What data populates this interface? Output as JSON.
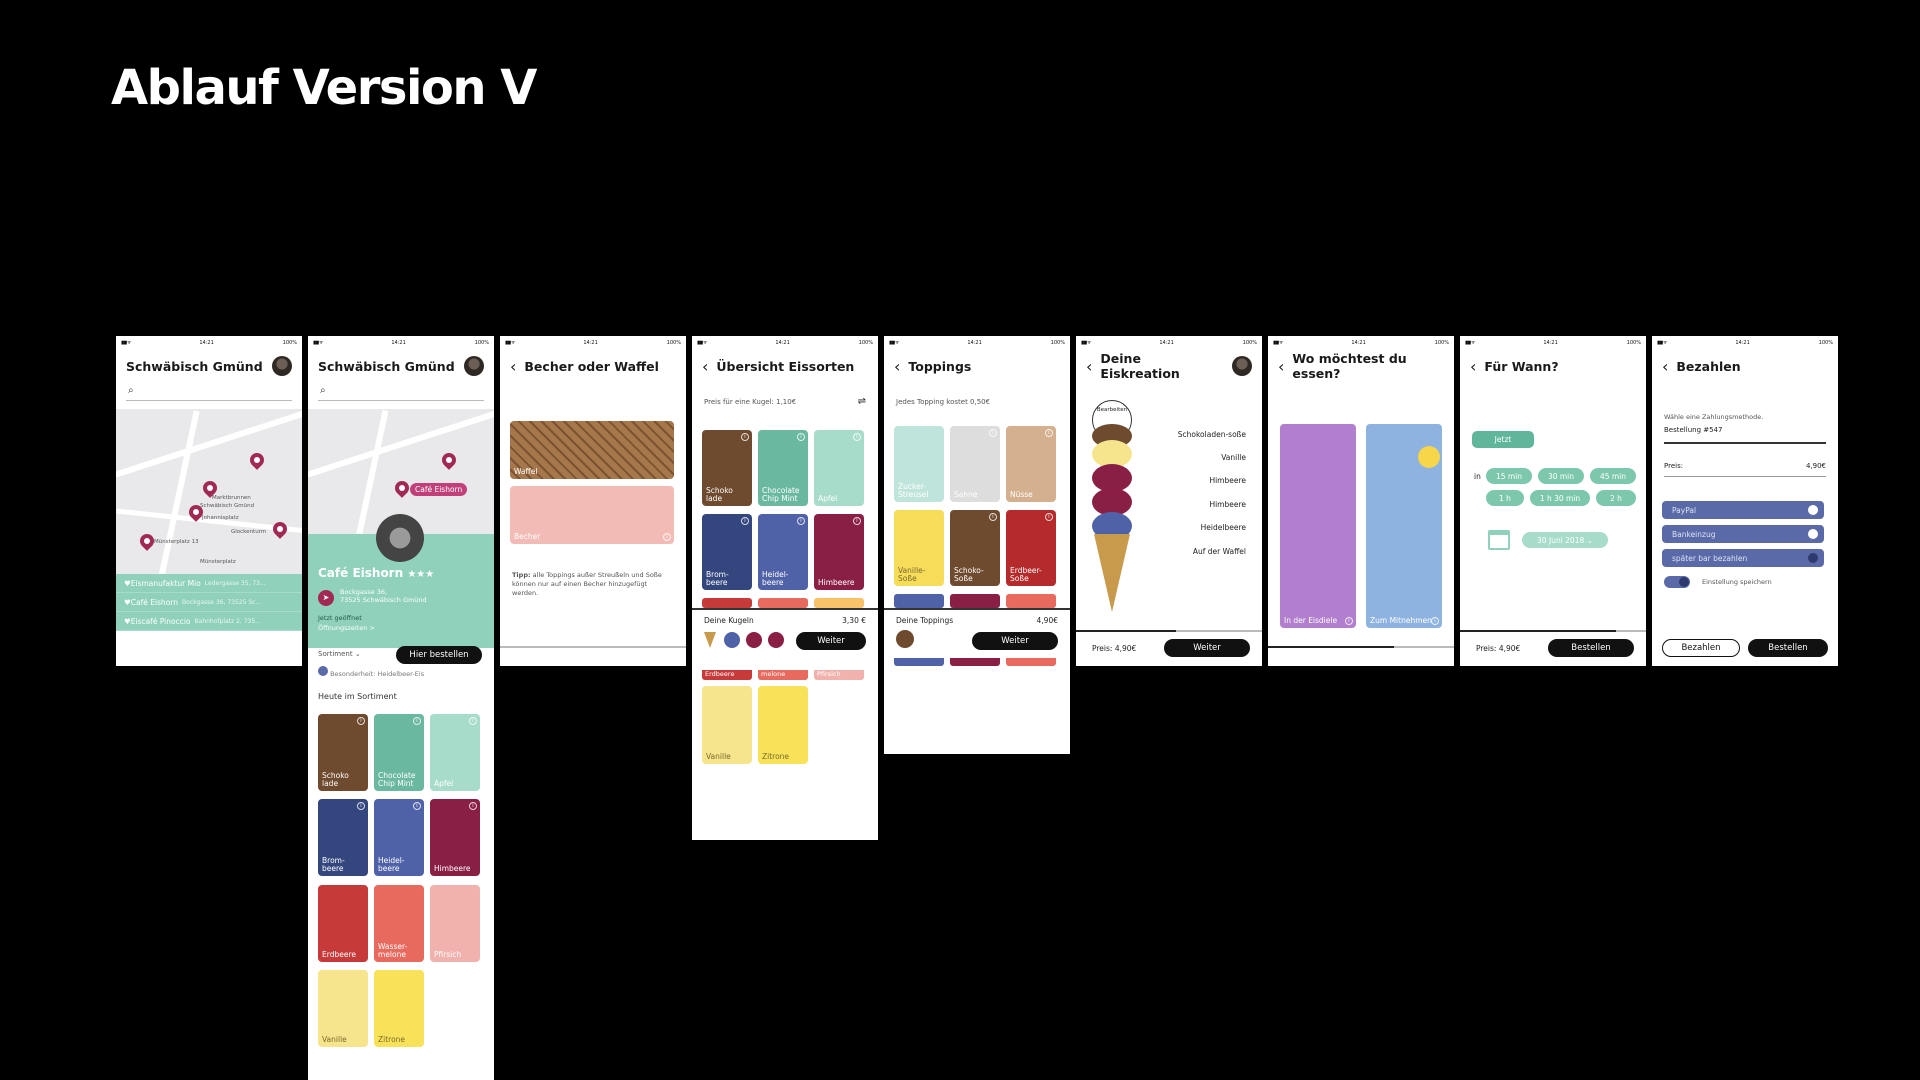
{
  "page_title": "Ablauf Version V",
  "status": {
    "time": "14:21",
    "battery": "100%"
  },
  "screen1": {
    "title": "Schwäbisch Gmünd",
    "map_labels": [
      "Marktbrunnen",
      "Schwäbisch Gmünd",
      "Johannisplatz",
      "Glockenturm",
      "Münsterplatz 13",
      "Münsterplatz",
      "Münsterplatz"
    ],
    "places": [
      {
        "name": "Eismanufaktur Mio",
        "addr": "Ledergasse 35, 73..."
      },
      {
        "name": "Café Eishorn",
        "addr": "Bockgasse 36, 73525 Sc..."
      },
      {
        "name": "Eiscafé Pinoccio",
        "addr": "Bahnhofplatz 2, 735..."
      }
    ]
  },
  "screen2": {
    "title": "Schwäbisch Gmünd",
    "pin_label": "Café Eishorn",
    "cafe_name": "Café Eishorn",
    "stars": "★★★",
    "address1": "Bockgasse 36,",
    "address2": "73525 Schwäbisch Gmünd",
    "open_now": "Jetzt geöffnet",
    "opening_hours": "Öffnungszeiten >",
    "assortment": "Sortiment",
    "order_button": "Hier bestellen",
    "special": "Besonderheit: Heidelbeer-Eis",
    "today_heading": "Heute im Sortiment",
    "flavors": [
      "Schoko lade",
      "Chocolate Chip Mint",
      "Apfel",
      "Brom- beere",
      "Heidel- beere",
      "Himbeere",
      "Erdbeere",
      "Wasser- melone",
      "Pfirsich",
      "Vanille",
      "Zitrone"
    ]
  },
  "screen3": {
    "title": "Becher oder Waffel",
    "option1": "Waffel",
    "option2": "Becher",
    "tip_bold": "Tipp:",
    "tip": "alle Toppings außer Streußeln und Soße können nur auf einen Becher hinzugefügt werden."
  },
  "screen4": {
    "title": "Übersicht Eissorten",
    "price_note": "Preis für eine Kugel: 1,10€",
    "flavors": [
      "Schoko lade",
      "Chocolate Chip Mint",
      "Apfel",
      "Brom- beere",
      "Heidel- beere",
      "Himbeere"
    ],
    "flavors_lower": [
      "Erdbeere",
      "melone",
      "Pfirsich",
      "Vanille",
      "Zitrone"
    ],
    "scoops_label": "Deine Kugeln",
    "scoops_price": "3,30 €",
    "next": "Weiter"
  },
  "screen5": {
    "title": "Toppings",
    "price_note": "Jedes Topping kostet 0,50€",
    "toppings": [
      "Zucker- Streusel",
      "Sahne",
      "Nüsse",
      "Vanille- Soße",
      "Schoko- Soße",
      "Erdbeer- Soße"
    ],
    "toppings_label": "Deine Toppings",
    "toppings_price": "4,90€",
    "next": "Weiter"
  },
  "screen6": {
    "title": "Deine Eiskreation",
    "edit": "Bearbeiten",
    "layers": [
      "Schokoladen-soße",
      "Vanille",
      "Himbeere",
      "Himbeere",
      "Heidelbeere",
      "Auf der Waffel"
    ],
    "price": "Preis: 4,90€",
    "next": "Weiter"
  },
  "screen7": {
    "title": "Wo möchtest du essen?",
    "option1": "In der Eisdiele",
    "option2": "Zum Mitnehmen"
  },
  "screen8": {
    "title": "Für Wann?",
    "now": "Jetzt",
    "in_label": "in",
    "times": [
      "15 min",
      "30 min",
      "45 min",
      "1 h",
      "1 h 30 min",
      "2 h"
    ],
    "date": "30 Juni 2018",
    "price": "Preis: 4,90€",
    "order": "Bestellen"
  },
  "screen9": {
    "title": "Bezahlen",
    "hint": "Wähle eine Zahlungsmethode.",
    "order_no": "Bestellung #547",
    "price_label": "Preis:",
    "price_value": "4,90€",
    "methods": [
      "PayPal",
      "Bankeinzug",
      "später bar bezahlen"
    ],
    "save": "Einstellung speichern",
    "pay": "Bezahlen",
    "order": "Bestellen"
  }
}
